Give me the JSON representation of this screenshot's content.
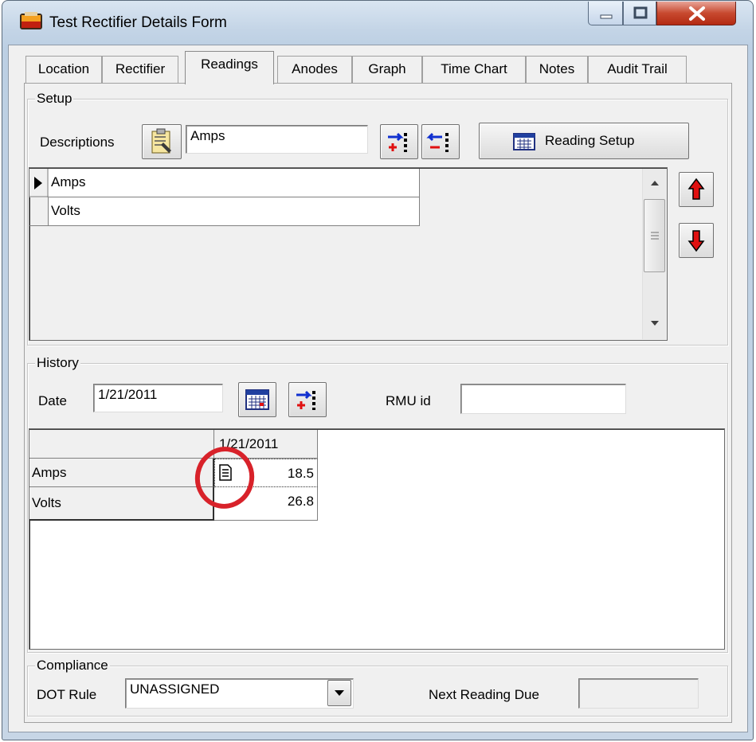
{
  "window": {
    "title": "Test Rectifier Details Form"
  },
  "tabs": [
    {
      "label": "Location"
    },
    {
      "label": "Rectifier"
    },
    {
      "label": "Readings"
    },
    {
      "label": "Anodes"
    },
    {
      "label": "Graph"
    },
    {
      "label": "Time Chart"
    },
    {
      "label": "Notes"
    },
    {
      "label": "Audit Trail"
    }
  ],
  "active_tab": "Readings",
  "setup": {
    "legend": "Setup",
    "descriptions_label": "Descriptions",
    "descriptions_value": "Amps",
    "reading_setup_label": "Reading Setup",
    "rows": [
      "Amps",
      "Volts"
    ]
  },
  "history": {
    "legend": "History",
    "date_label": "Date",
    "date_value": "1/21/2011",
    "rmu_label": "RMU id",
    "rmu_value": "",
    "column_header": "1/21/2011",
    "rows": [
      {
        "label": "Amps",
        "value": "18.5"
      },
      {
        "label": "Volts",
        "value": "26.8"
      }
    ]
  },
  "compliance": {
    "legend": "Compliance",
    "dot_rule_label": "DOT Rule",
    "dot_rule_value": "UNASSIGNED",
    "next_reading_label": "Next Reading Due",
    "next_reading_value": ""
  },
  "colors": {
    "annotation_circle": "#d8222a",
    "arrow_red": "#e01010"
  }
}
